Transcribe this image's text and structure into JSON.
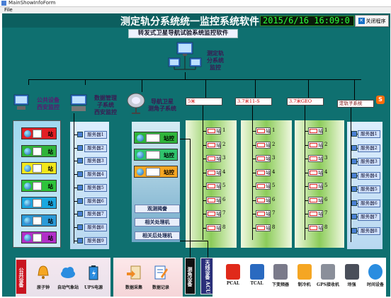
{
  "window": {
    "title": "MainShowInfoForm",
    "menu": [
      "File"
    ]
  },
  "header": {
    "title": "测定轨分系统统一监控系统软件",
    "clock": "2015/6/16 16:09:0",
    "close_label": "关闭程序",
    "subtitle": "转发式卫星导航试验系统监控软件"
  },
  "center_node": {
    "label_lines": [
      "测定轨",
      "分系统",
      "监控"
    ]
  },
  "left_nodes": [
    {
      "lines": [
        "公共设备",
        "西安监控"
      ]
    },
    {
      "lines": [
        "数据管理",
        "子系统",
        "西安监控"
      ]
    },
    {
      "lines": [
        "导航卫星",
        "测角子系统"
      ]
    }
  ],
  "top_boxes": [
    "5米",
    "3.7米11-S",
    "3.7米GEO",
    "定轨子系统"
  ],
  "stations_left": [
    {
      "label": "站",
      "color": "#e31e24"
    },
    {
      "label": "站",
      "color": "#2fb43a"
    },
    {
      "label": "站",
      "color": "#f2e71a"
    },
    {
      "label": "站",
      "color": "#2ec43b"
    },
    {
      "label": "站",
      "color": "#1aa8e0"
    },
    {
      "label": "站",
      "color": "#2a9ad8"
    },
    {
      "label": "站",
      "color": "#b12fc8"
    }
  ],
  "servers_col1": [
    "服务器1",
    "服务器2",
    "服务器3",
    "服务器4",
    "服务器5",
    "服务器6",
    "服务器7",
    "服务器8",
    "服务器9"
  ],
  "servers_right": [
    "服务器1",
    "服务器2",
    "服务器3",
    "服务器4",
    "服务器5",
    "服务器6",
    "服务器7",
    "服务器8"
  ],
  "angle_stations": [
    {
      "label": "站控",
      "color": "#2fb43a"
    },
    {
      "label": "站控",
      "color": "#2fc36c"
    },
    {
      "label": "站控",
      "color": "#f5a623"
    }
  ],
  "angle_processes": [
    "观测揭誊",
    "相关处理机",
    "相关后处理机"
  ],
  "sub_station_label": "站",
  "sub_numbers": [
    "1",
    "2",
    "3",
    "4",
    "5",
    "6",
    "7",
    "8"
  ],
  "bottom": {
    "public_label": "公共设备",
    "public_devices": [
      "原子钟",
      "自动气象站",
      "UPS电源"
    ],
    "data_devices": [
      "数据采集",
      "数据记录"
    ],
    "angle_label": "测角设备",
    "acu_label": "天线设备 ACU",
    "right_devices": [
      "PCAL",
      "TCAL",
      "下变频器",
      "制冷机",
      "GPS接收机",
      "场强",
      "时间设备"
    ]
  }
}
